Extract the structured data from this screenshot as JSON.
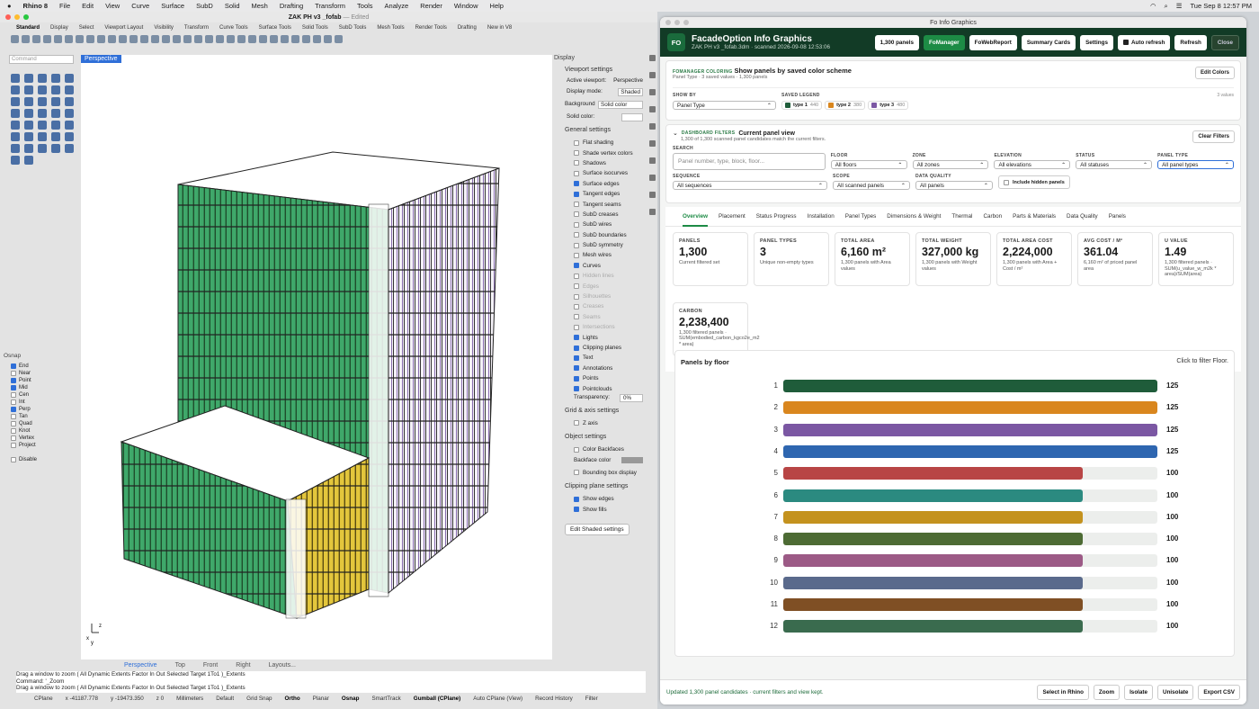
{
  "menubar": {
    "app": "Rhino 8",
    "items": [
      "File",
      "Edit",
      "View",
      "Curve",
      "Surface",
      "SubD",
      "Solid",
      "Mesh",
      "Drafting",
      "Transform",
      "Tools",
      "Analyze",
      "Render",
      "Window",
      "Help"
    ],
    "clock": "Tue Sep 8  12:57 PM"
  },
  "rhino": {
    "title": "ZAK PH v3 _fofab",
    "title_suffix": "— Edited",
    "tabs": [
      "Standard",
      "Display",
      "Select",
      "Viewport Layout",
      "Visibility",
      "Transform",
      "Curve Tools",
      "Surface Tools",
      "Solid Tools",
      "SubD Tools",
      "Mesh Tools",
      "Render Tools",
      "Drafting",
      "New in V8"
    ],
    "command_placeholder": "Command",
    "viewport_label": "Perspective",
    "viewport_tabs": [
      "Perspective",
      "Top",
      "Front",
      "Right",
      "Layouts..."
    ],
    "osnap": {
      "title": "Osnap",
      "items": [
        {
          "l": "End",
          "on": true
        },
        {
          "l": "Near",
          "on": false
        },
        {
          "l": "Point",
          "on": true
        },
        {
          "l": "Mid",
          "on": true
        },
        {
          "l": "Cen",
          "on": false
        },
        {
          "l": "Int",
          "on": false
        },
        {
          "l": "Perp",
          "on": true
        },
        {
          "l": "Tan",
          "on": false
        },
        {
          "l": "Quad",
          "on": false
        },
        {
          "l": "Knot",
          "on": false
        },
        {
          "l": "Vertex",
          "on": false
        },
        {
          "l": "Project",
          "on": false
        }
      ],
      "disable": "Disable"
    },
    "display": {
      "panel_title": "Display",
      "viewport_settings": "Viewport settings",
      "active_viewport_label": "Active viewport:",
      "active_viewport": "Perspective",
      "display_mode_label": "Display mode:",
      "display_mode": "Shaded",
      "background_label": "Background",
      "background": "Solid color",
      "solid_color_label": "Solid color:",
      "general": "General settings",
      "checks": [
        {
          "l": "Flat shading",
          "on": false,
          "dis": false
        },
        {
          "l": "Shade vertex colors",
          "on": false,
          "dis": false
        },
        {
          "l": "Shadows",
          "on": false,
          "dis": false
        },
        {
          "l": "Surface isocurves",
          "on": false,
          "dis": false
        },
        {
          "l": "Surface edges",
          "on": true,
          "dis": false
        },
        {
          "l": "Tangent edges",
          "on": true,
          "dis": false
        },
        {
          "l": "Tangent seams",
          "on": false,
          "dis": false
        },
        {
          "l": "SubD creases",
          "on": false,
          "dis": false
        },
        {
          "l": "SubD wires",
          "on": false,
          "dis": false
        },
        {
          "l": "SubD boundaries",
          "on": false,
          "dis": false
        },
        {
          "l": "SubD symmetry",
          "on": false,
          "dis": false
        },
        {
          "l": "Mesh wires",
          "on": false,
          "dis": false
        },
        {
          "l": "Curves",
          "on": true,
          "dis": false
        },
        {
          "l": "Hidden lines",
          "on": false,
          "dis": true
        },
        {
          "l": "Edges",
          "on": false,
          "dis": true
        },
        {
          "l": "Silhouettes",
          "on": false,
          "dis": true
        },
        {
          "l": "Creases",
          "on": false,
          "dis": true
        },
        {
          "l": "Seams",
          "on": false,
          "dis": true
        },
        {
          "l": "Intersections",
          "on": false,
          "dis": true
        },
        {
          "l": "Lights",
          "on": true,
          "dis": false
        },
        {
          "l": "Clipping planes",
          "on": true,
          "dis": false
        },
        {
          "l": "Text",
          "on": true,
          "dis": false
        },
        {
          "l": "Annotations",
          "on": true,
          "dis": false
        },
        {
          "l": "Points",
          "on": true,
          "dis": false
        },
        {
          "l": "Pointclouds",
          "on": true,
          "dis": false
        }
      ],
      "transparency_label": "Transparency:",
      "transparency": "0%",
      "grid": "Grid & axis settings",
      "z_axis": "Z axis",
      "object": "Object settings",
      "color_backfaces": "Color Backfaces",
      "backface_color": "Backface color",
      "bbox": "Bounding box display",
      "clip": "Clipping plane settings",
      "show_edges": "Show edges",
      "show_fills": "Show fills",
      "edit_shaded": "Edit Shaded settings"
    },
    "command_history": [
      "Drag a window to zoom ( All Dynamic Extents Factor In Out Selected Target 1To1 )_Extents",
      "Command: '_Zoom",
      "Drag a window to zoom ( All Dynamic Extents Factor In Out Selected Target 1To1 )_Extents"
    ],
    "status": {
      "cplane": "CPlane",
      "x": "x -41187.778",
      "y": "y -19473.350",
      "z": "z 0",
      "units": "Millimeters",
      "layer": "Default",
      "grid_snap": "Grid Snap",
      "ortho": "Ortho",
      "planar": "Planar",
      "osnap": "Osnap",
      "smarttrack": "SmartTrack",
      "gumball": "Gumball (CPlane)",
      "autocplane": "Auto CPlane (View)",
      "record": "Record History",
      "filter": "Filter"
    }
  },
  "fo": {
    "window_title": "Fo Info Graphics",
    "logo": "FO",
    "title": "FacadeOption Info Graphics",
    "subtitle": "ZAK PH v3 _fofab.3dm · scanned 2026-09-08 12:53:06",
    "header_buttons": {
      "panels": "1,300 panels",
      "fomanager": "FoManager",
      "fowebreport": "FoWebReport",
      "summary": "Summary Cards",
      "settings": "Settings",
      "autorefresh": "Auto refresh",
      "refresh": "Refresh",
      "close": "Close"
    },
    "coloring": {
      "kicker": "FOMANAGER COLORING",
      "title": "Show panels by saved color scheme",
      "sub": "Panel Type · 3 saved values · 1,300 panels",
      "edit": "Edit Colors",
      "show_by_label": "SHOW BY",
      "show_by": "Panel Type",
      "legend_label": "SAVED LEGEND",
      "values_count": "3 values",
      "legend": [
        {
          "name": "type 1",
          "n": "440",
          "color": "#1f5c3a"
        },
        {
          "name": "type 2",
          "n": "380",
          "color": "#d9861e"
        },
        {
          "name": "type 3",
          "n": "480",
          "color": "#7b57a3"
        }
      ]
    },
    "filters": {
      "kicker": "DASHBOARD FILTERS",
      "title": "Current panel view",
      "sub": "1,300 of 1,300 scanned panel candidates match the current filters.",
      "clear": "Clear Filters",
      "search_label": "SEARCH",
      "search_placeholder": "Panel number, type, block, floor...",
      "floor_label": "FLOOR",
      "floor": "All floors",
      "zone_label": "ZONE",
      "zone": "All zones",
      "elevation_label": "ELEVATION",
      "elevation": "All elevations",
      "status_label": "STATUS",
      "status": "All statuses",
      "ptype_label": "PANEL TYPE",
      "ptype": "All panel types",
      "sequence_label": "SEQUENCE",
      "sequence": "All sequences",
      "scope_label": "SCOPE",
      "scope": "All scanned panels",
      "dq_label": "DATA QUALITY",
      "dq": "All panels",
      "hidden": "Include hidden panels"
    },
    "tabs": [
      "Overview",
      "Placement",
      "Status Progress",
      "Installation",
      "Panel Types",
      "Dimensions & Weight",
      "Thermal",
      "Carbon",
      "Parts & Materials",
      "Data Quality",
      "Panels"
    ],
    "metrics": [
      {
        "l": "PANELS",
        "v": "1,300",
        "d": "Current filtered set"
      },
      {
        "l": "PANEL TYPES",
        "v": "3",
        "d": "Unique non-empty types"
      },
      {
        "l": "TOTAL AREA",
        "v": "6,160 m²",
        "d": "1,300 panels with Area values"
      },
      {
        "l": "TOTAL WEIGHT",
        "v": "327,000 kg",
        "d": "1,300 panels with Weight values"
      },
      {
        "l": "TOTAL AREA COST",
        "v": "2,224,000",
        "d": "1,300 panels with Area + Cost / m²"
      },
      {
        "l": "AVG COST / M²",
        "v": "361.04",
        "d": "6,160 m² of priced panel area"
      },
      {
        "l": "U VALUE",
        "v": "1.49",
        "d": "1,300 filtered panels · SUM(u_value_w_m2k * area)/SUM(area)"
      },
      {
        "l": "CARBON",
        "v": "2,238,400",
        "d": "1,300 filtered panels · SUM(embodied_carbon_kgco2e_m2 * area)"
      }
    ],
    "footer": {
      "msg": "Updated 1,300 panel candidates · current filters and view kept.",
      "select": "Select in Rhino",
      "zoom": "Zoom",
      "isolate": "Isolate",
      "unisolate": "Unisolate",
      "export": "Export CSV"
    }
  },
  "chart_data": {
    "type": "bar",
    "orientation": "horizontal",
    "title": "Panels by floor",
    "hint": "Click to filter Floor.",
    "categories": [
      "1",
      "2",
      "3",
      "4",
      "5",
      "6",
      "7",
      "8",
      "9",
      "10",
      "11",
      "12"
    ],
    "values": [
      125,
      125,
      125,
      125,
      100,
      100,
      100,
      100,
      100,
      100,
      100,
      100
    ],
    "labels": [
      "125",
      "125",
      "125",
      "125",
      "100",
      "100",
      "100",
      "100",
      "100",
      "100",
      "100",
      "100"
    ],
    "xlim": [
      0,
      125
    ],
    "colors": [
      "#1f5c3a",
      "#d9861e",
      "#7b57a3",
      "#2e66b0",
      "#b84545",
      "#2b8a80",
      "#c4921e",
      "#4d6b34",
      "#9c5a86",
      "#5a6a8c",
      "#7f4f24",
      "#3a6b4e"
    ]
  }
}
